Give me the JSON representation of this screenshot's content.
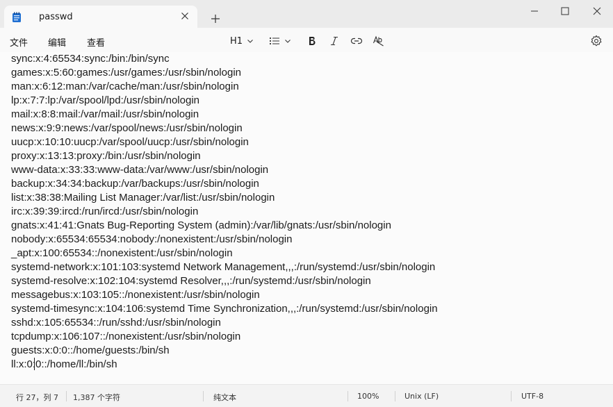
{
  "tab": {
    "title": "passwd"
  },
  "menu": {
    "file": "文件",
    "edit": "编辑",
    "view": "查看"
  },
  "toolbar": {
    "heading": "H1"
  },
  "editor": {
    "lines": [
      "sync:x:4:65534:sync:/bin:/bin/sync",
      "games:x:5:60:games:/usr/games:/usr/sbin/nologin",
      "man:x:6:12:man:/var/cache/man:/usr/sbin/nologin",
      "lp:x:7:7:lp:/var/spool/lpd:/usr/sbin/nologin",
      "mail:x:8:8:mail:/var/mail:/usr/sbin/nologin",
      "news:x:9:9:news:/var/spool/news:/usr/sbin/nologin",
      "uucp:x:10:10:uucp:/var/spool/uucp:/usr/sbin/nologin",
      "proxy:x:13:13:proxy:/bin:/usr/sbin/nologin",
      "www-data:x:33:33:www-data:/var/www:/usr/sbin/nologin",
      "backup:x:34:34:backup:/var/backups:/usr/sbin/nologin",
      "list:x:38:38:Mailing List Manager:/var/list:/usr/sbin/nologin",
      "irc:x:39:39:ircd:/run/ircd:/usr/sbin/nologin",
      "gnats:x:41:41:Gnats Bug-Reporting System (admin):/var/lib/gnats:/usr/sbin/nologin",
      "nobody:x:65534:65534:nobody:/nonexistent:/usr/sbin/nologin",
      "_apt:x:100:65534::/nonexistent:/usr/sbin/nologin",
      "systemd-network:x:101:103:systemd Network Management,,,:/run/systemd:/usr/sbin/nologin",
      "systemd-resolve:x:102:104:systemd Resolver,,,:/run/systemd:/usr/sbin/nologin",
      "messagebus:x:103:105::/nonexistent:/usr/sbin/nologin",
      "systemd-timesync:x:104:106:systemd Time Synchronization,,,:/run/systemd:/usr/sbin/nologin",
      "sshd:x:105:65534::/run/sshd:/usr/sbin/nologin",
      "tcpdump:x:106:107::/nonexistent:/usr/sbin/nologin",
      "guests:x:0:0::/home/guests:/bin/sh",
      "ll:x:0:0::/home/ll:/bin/sh"
    ]
  },
  "status": {
    "position": "行 27，列 7",
    "char_count": "1,387 个字符",
    "format": "纯文本",
    "zoom": "100%",
    "line_ending": "Unix (LF)",
    "encoding": "UTF-8"
  }
}
